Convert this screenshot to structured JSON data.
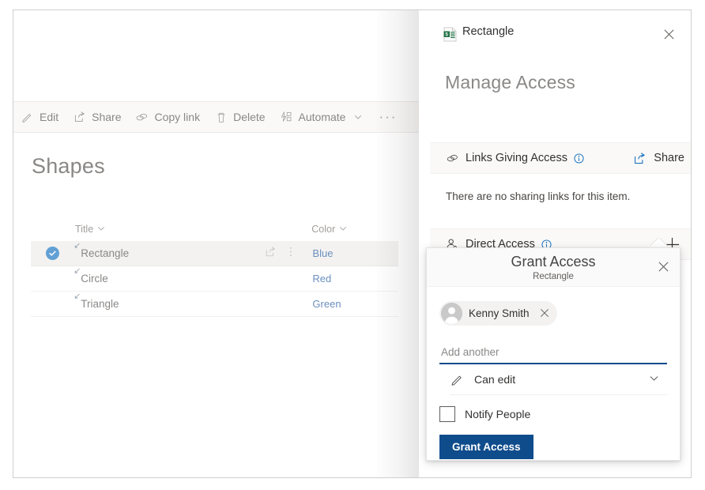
{
  "panel": {
    "title": "Rectangle",
    "doc_icon": "sharepoint-list-file-icon",
    "close_icon": "close-icon",
    "heading": "Manage Access",
    "links_section": {
      "icon": "link-icon",
      "label": "Links Giving Access",
      "info_icon": "info-icon",
      "share_icon": "share-icon",
      "share_label": "Share",
      "empty_text": "There are no sharing links for this item."
    },
    "direct_section": {
      "icon": "person-icon",
      "label": "Direct Access",
      "info_icon": "info-icon",
      "add_icon": "plus-icon"
    }
  },
  "commandbar": {
    "items": [
      {
        "label": "Edit",
        "icon": "pencil-icon",
        "chevron": false
      },
      {
        "label": "Share",
        "icon": "share-icon",
        "chevron": false
      },
      {
        "label": "Copy link",
        "icon": "link-icon",
        "chevron": false
      },
      {
        "label": "Delete",
        "icon": "trash-icon",
        "chevron": false
      },
      {
        "label": "Automate",
        "icon": "automate-icon",
        "chevron": true
      }
    ],
    "overflow_label": "···"
  },
  "list": {
    "title": "Shapes",
    "columns": [
      {
        "label": "Title",
        "sort_icon": "chevron-down-icon"
      },
      {
        "label": "Color",
        "sort_icon": "chevron-down-icon"
      }
    ],
    "rows": [
      {
        "title": "Rectangle",
        "color": "Blue",
        "selected": true,
        "shared_icon": "shared-indicator-icon",
        "share_icon": "share-icon",
        "more_icon": "more-vertical-icon"
      },
      {
        "title": "Circle",
        "color": "Red",
        "selected": false,
        "shared_icon": "shared-indicator-icon",
        "share_icon": "",
        "more_icon": ""
      },
      {
        "title": "Triangle",
        "color": "Green",
        "selected": false,
        "shared_icon": "shared-indicator-icon",
        "share_icon": "",
        "more_icon": ""
      }
    ]
  },
  "grant_access": {
    "title": "Grant Access",
    "subtitle": "Rectangle",
    "close_icon": "close-icon",
    "person": {
      "name": "Kenny Smith",
      "avatar_icon": "person-avatar-icon",
      "remove_icon": "remove-person-icon"
    },
    "add_another_placeholder": "Add another",
    "add_another_value": "",
    "permission": {
      "icon": "pencil-icon",
      "label": "Can edit",
      "chevron_icon": "chevron-down-icon"
    },
    "notify": {
      "label": "Notify People",
      "checked": false
    },
    "submit_label": "Grant Access"
  },
  "colors": {
    "accent": "#0f4c8c",
    "link": "#6b8fbf",
    "selection": "#61a0d4",
    "muted_text": "#8a8886",
    "panel_section_bg": "#faf9f8"
  }
}
